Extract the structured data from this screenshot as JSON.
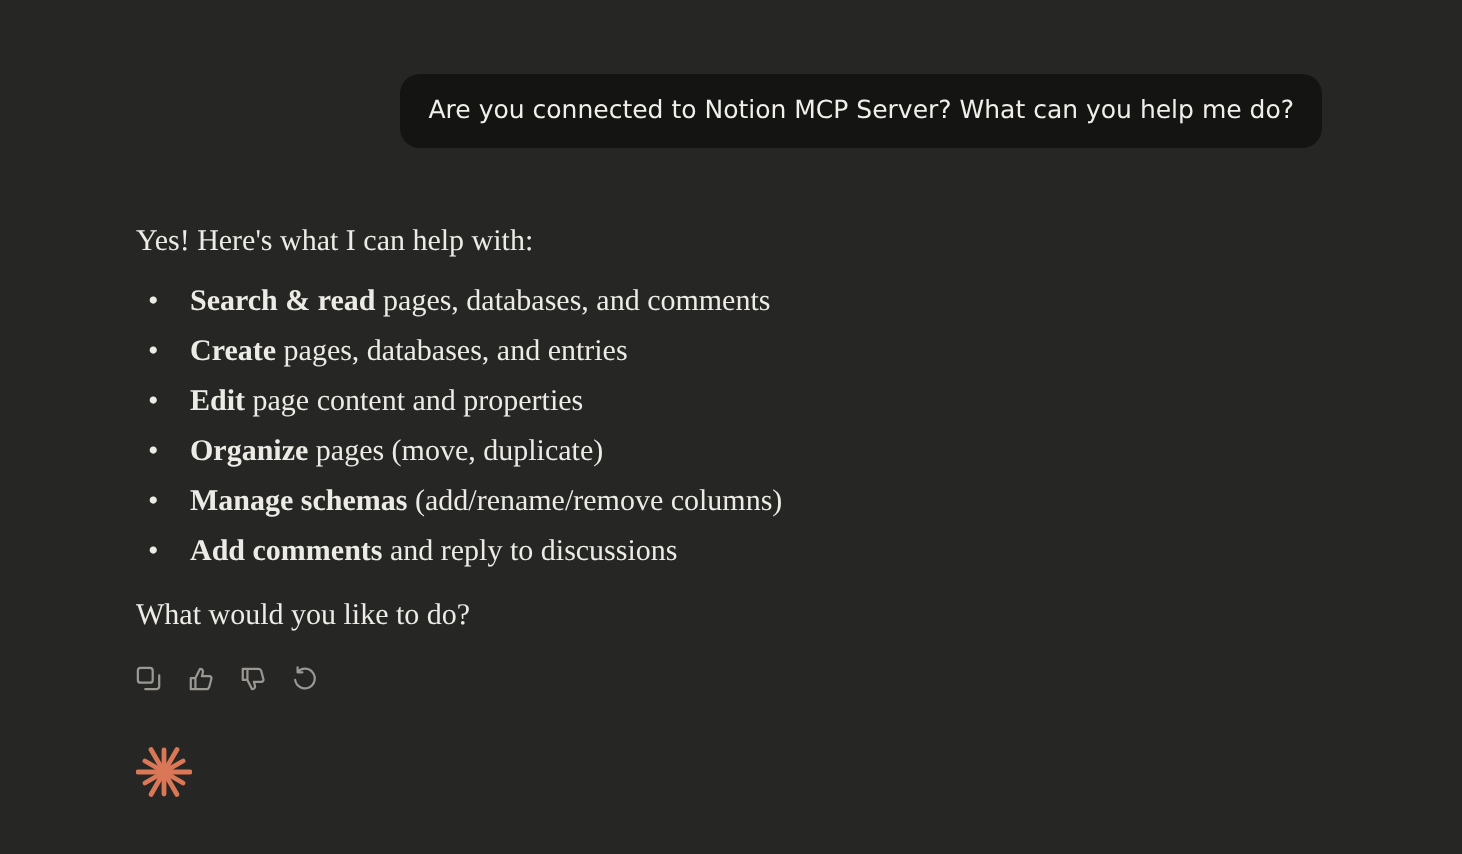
{
  "user_message": "Are you connected to Notion MCP Server? What can you help me do?",
  "reply": {
    "intro": "Yes! Here's what I can help with:",
    "bullets": [
      {
        "marker": "•",
        "text": "**Search & read** pages, databases, and comments"
      },
      {
        "marker": "•",
        "text": "**Create** pages, databases, and entries"
      },
      {
        "marker": "•",
        "text": "**Edit** page content and properties"
      },
      {
        "marker": "•",
        "text": "**Organize** pages (move, duplicate)"
      },
      {
        "marker": "•",
        "text": "**Manage schemas** (add/rename/remove columns)"
      },
      {
        "marker": "•",
        "text": "**Add comments** and reply to discussions"
      }
    ],
    "closing": "What would you like to do?"
  }
}
